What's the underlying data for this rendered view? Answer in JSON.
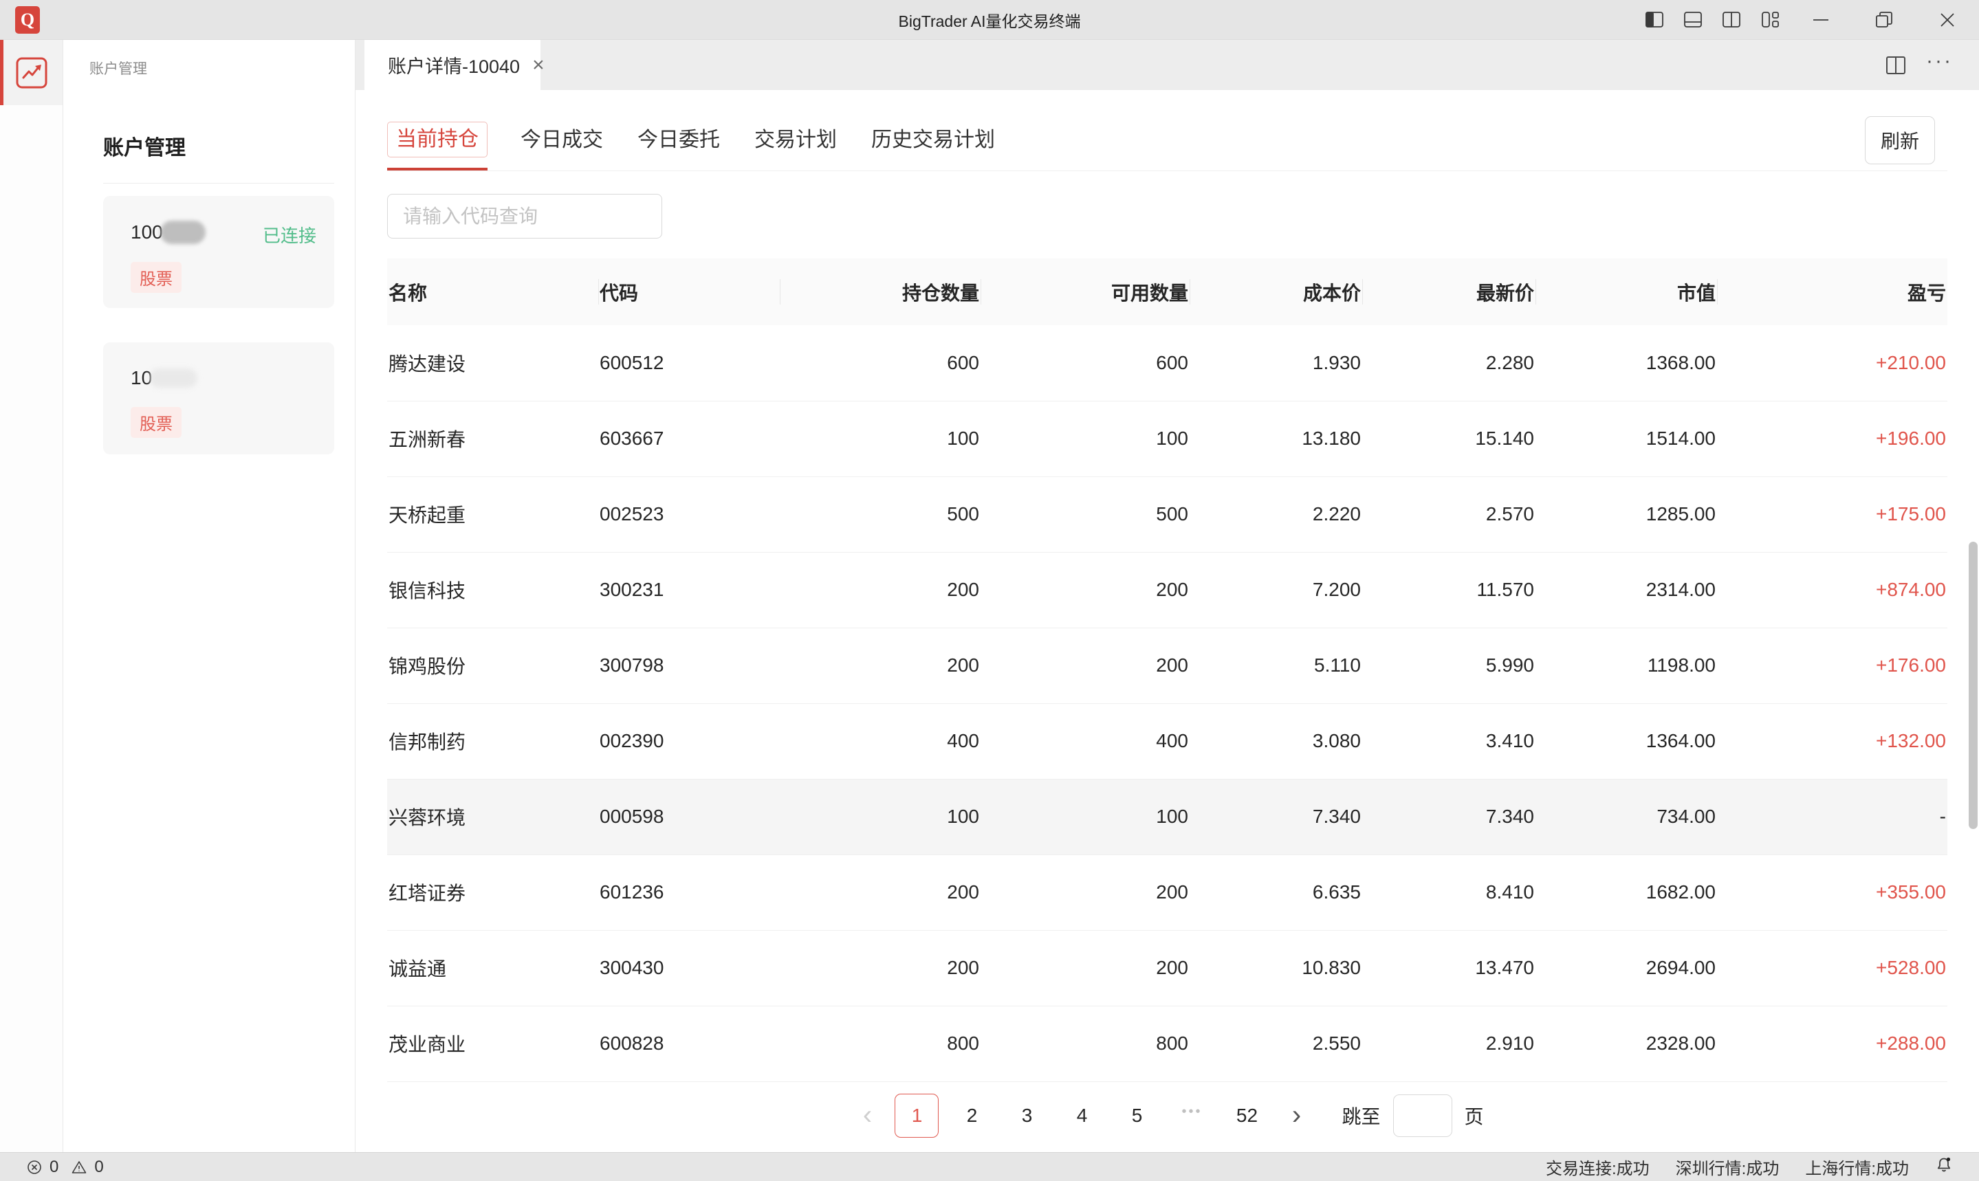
{
  "titlebar": {
    "logo": "Q",
    "title": "BigTrader AI量化交易终端"
  },
  "sidebar": {
    "section_label": "账户管理",
    "heading": "账户管理",
    "accounts": [
      {
        "id": "100",
        "status": "已连接",
        "tag": "股票"
      },
      {
        "id": "10",
        "status": "",
        "tag": "股票"
      }
    ]
  },
  "doc_tab": {
    "title": "账户详情-10040",
    "close": "×"
  },
  "view_tabs": {
    "active_index": 0,
    "items": [
      "当前持仓",
      "今日成交",
      "今日委托",
      "交易计划",
      "历史交易计划"
    ]
  },
  "toolbar": {
    "refresh_label": "刷新"
  },
  "search": {
    "placeholder": "请输入代码查询",
    "value": ""
  },
  "table": {
    "columns": [
      "名称",
      "代码",
      "持仓数量",
      "可用数量",
      "成本价",
      "最新价",
      "市值",
      "盈亏"
    ],
    "rows": [
      {
        "name": "腾达建设",
        "code": "600512",
        "qty": "600",
        "available": "600",
        "cost": "1.930",
        "last": "2.280",
        "market_value": "1368.00",
        "pnl": "+210.00",
        "highlighted": false
      },
      {
        "name": "五洲新春",
        "code": "603667",
        "qty": "100",
        "available": "100",
        "cost": "13.180",
        "last": "15.140",
        "market_value": "1514.00",
        "pnl": "+196.00",
        "highlighted": false
      },
      {
        "name": "天桥起重",
        "code": "002523",
        "qty": "500",
        "available": "500",
        "cost": "2.220",
        "last": "2.570",
        "market_value": "1285.00",
        "pnl": "+175.00",
        "highlighted": false
      },
      {
        "name": "银信科技",
        "code": "300231",
        "qty": "200",
        "available": "200",
        "cost": "7.200",
        "last": "11.570",
        "market_value": "2314.00",
        "pnl": "+874.00",
        "highlighted": false
      },
      {
        "name": "锦鸡股份",
        "code": "300798",
        "qty": "200",
        "available": "200",
        "cost": "5.110",
        "last": "5.990",
        "market_value": "1198.00",
        "pnl": "+176.00",
        "highlighted": false
      },
      {
        "name": "信邦制药",
        "code": "002390",
        "qty": "400",
        "available": "400",
        "cost": "3.080",
        "last": "3.410",
        "market_value": "1364.00",
        "pnl": "+132.00",
        "highlighted": false
      },
      {
        "name": "兴蓉环境",
        "code": "000598",
        "qty": "100",
        "available": "100",
        "cost": "7.340",
        "last": "7.340",
        "market_value": "734.00",
        "pnl": "-",
        "highlighted": true
      },
      {
        "name": "红塔证券",
        "code": "601236",
        "qty": "200",
        "available": "200",
        "cost": "6.635",
        "last": "8.410",
        "market_value": "1682.00",
        "pnl": "+355.00",
        "highlighted": false
      },
      {
        "name": "诚益通",
        "code": "300430",
        "qty": "200",
        "available": "200",
        "cost": "10.830",
        "last": "13.470",
        "market_value": "2694.00",
        "pnl": "+528.00",
        "highlighted": false
      },
      {
        "name": "茂业商业",
        "code": "600828",
        "qty": "800",
        "available": "800",
        "cost": "2.550",
        "last": "2.910",
        "market_value": "2328.00",
        "pnl": "+288.00",
        "highlighted": false
      }
    ]
  },
  "pagination": {
    "prev": "‹",
    "next": "›",
    "pages": [
      "1",
      "2",
      "3",
      "4",
      "5",
      "•••",
      "52"
    ],
    "active_page": "1",
    "jump_label": "跳至",
    "jump_value": "",
    "unit_label": "页"
  },
  "status_bar": {
    "error_count": "0",
    "warning_count": "0",
    "connections": [
      "交易连接:成功",
      "深圳行情:成功",
      "上海行情:成功"
    ]
  },
  "colors": {
    "accent_red": "#d6453c",
    "profit_red": "#e0544b",
    "success_green": "#53bd8b"
  }
}
